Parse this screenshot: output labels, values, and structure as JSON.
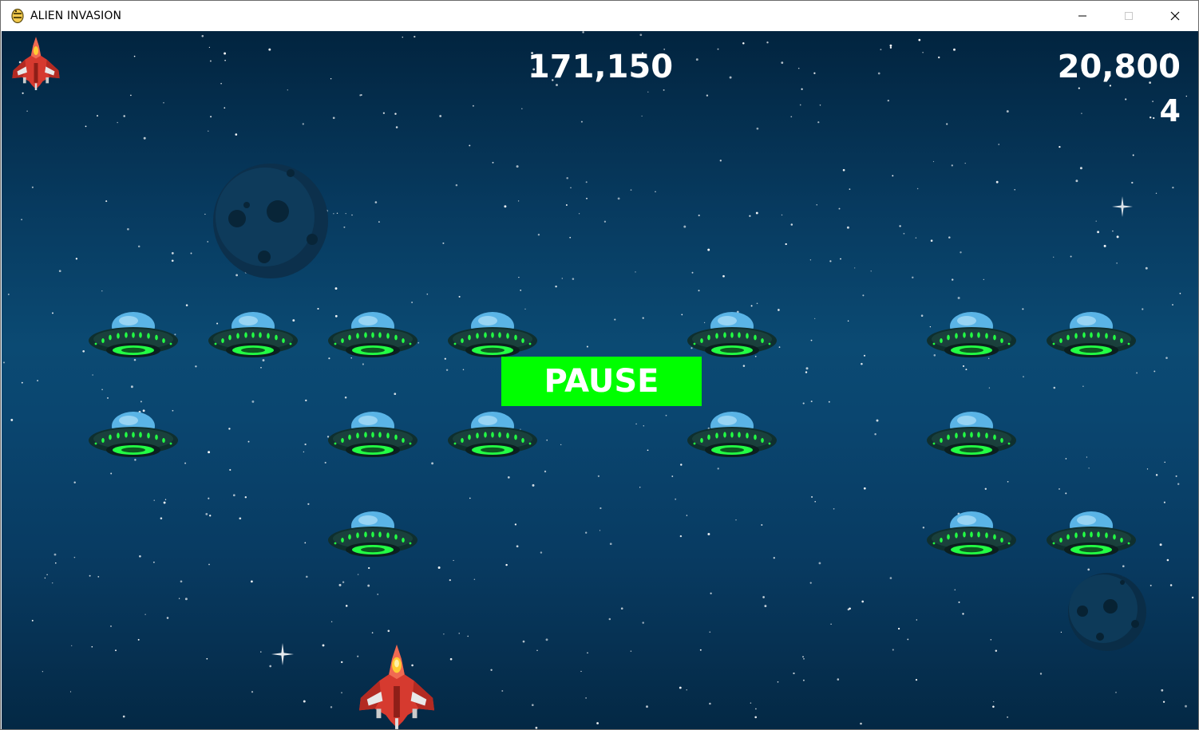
{
  "window": {
    "title": "ALIEN INVASION",
    "controls": [
      "minimize",
      "maximize",
      "close"
    ]
  },
  "hud": {
    "score": "171,150",
    "high_score": "20,800",
    "level": "4",
    "ships_left": 1
  },
  "pause_button": {
    "label": "PAUSE",
    "color": "#00ff00"
  },
  "aliens": [
    {
      "row": 1,
      "col": 1
    },
    {
      "row": 1,
      "col": 2
    },
    {
      "row": 1,
      "col": 3
    },
    {
      "row": 1,
      "col": 4
    },
    {
      "row": 1,
      "col": 6
    },
    {
      "row": 1,
      "col": 8
    },
    {
      "row": 1,
      "col": 9
    },
    {
      "row": 2,
      "col": 1
    },
    {
      "row": 2,
      "col": 3
    },
    {
      "row": 2,
      "col": 4
    },
    {
      "row": 2,
      "col": 6
    },
    {
      "row": 2,
      "col": 8
    },
    {
      "row": 3,
      "col": 3
    },
    {
      "row": 3,
      "col": 8
    },
    {
      "row": 3,
      "col": 9
    }
  ],
  "colors": {
    "background_top": "#02243f",
    "background_mid": "#0b4a73",
    "alien_glow": "#22ff44",
    "alien_dome": "#5ab4e6",
    "ship_red": "#d63a2f"
  }
}
